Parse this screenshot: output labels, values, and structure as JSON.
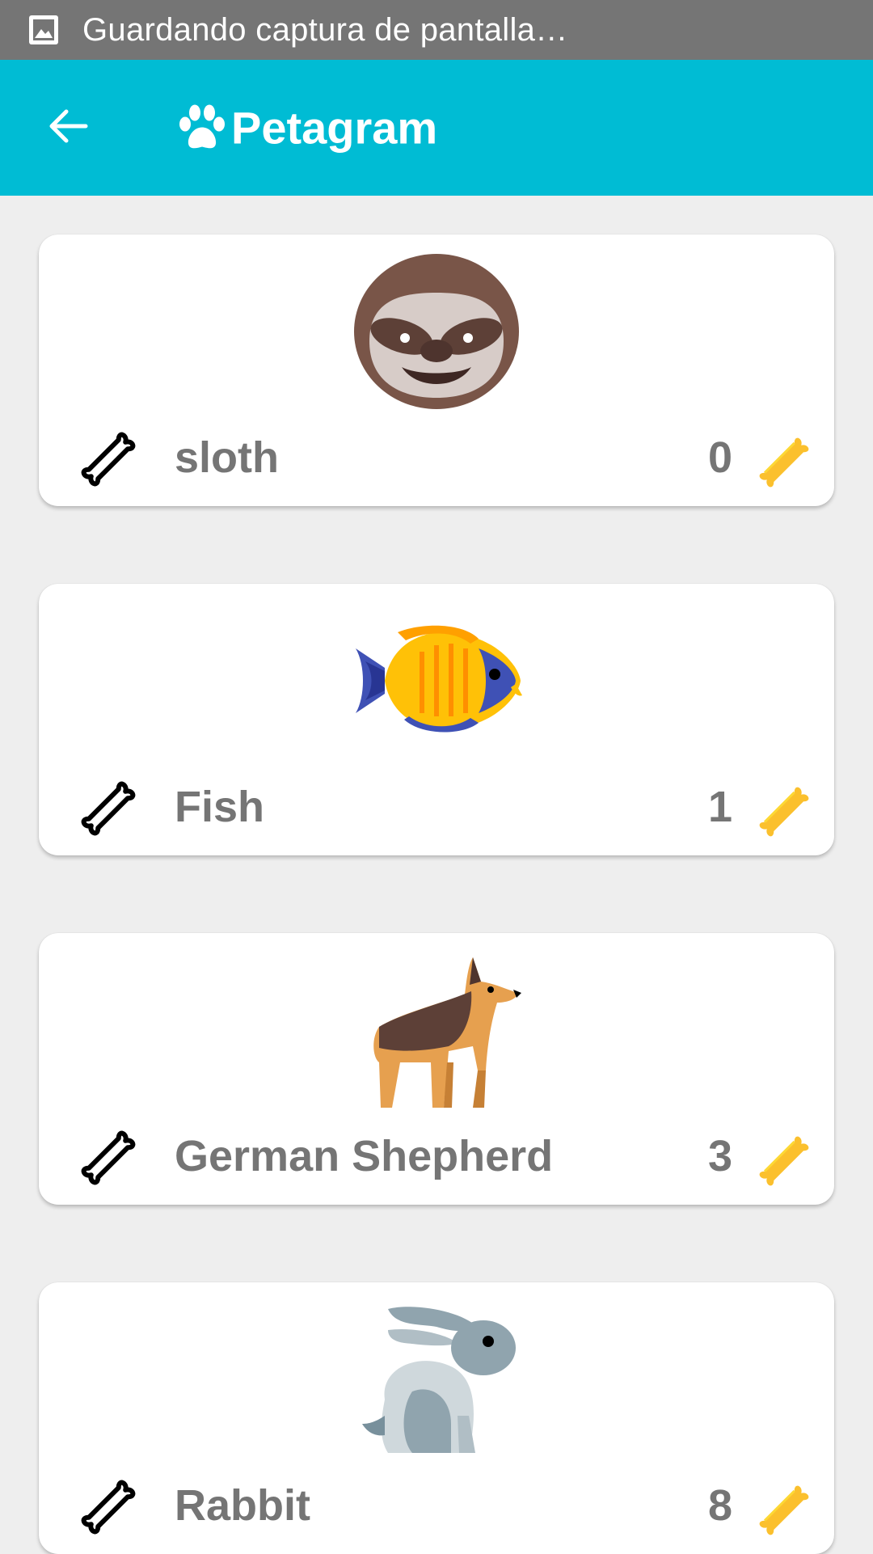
{
  "status_bar": {
    "icon": "image-icon",
    "text": "Guardando captura de pantalla…",
    "background": "#757575"
  },
  "app_bar": {
    "back_icon": "arrow-back-icon",
    "brand_icon": "paw-icon",
    "title": "Petagram",
    "background": "#00bcd4"
  },
  "pets": [
    {
      "name": "sloth",
      "likes": "0",
      "image": "sloth-icon"
    },
    {
      "name": "Fish",
      "likes": "1",
      "image": "fish-icon"
    },
    {
      "name": "German Shepherd",
      "likes": "3",
      "image": "german-shepherd-icon"
    },
    {
      "name": "Rabbit",
      "likes": "8",
      "image": "rabbit-icon"
    }
  ],
  "colors": {
    "text_gray": "#757575",
    "bone_gold": "#fbc02d",
    "bone_outline": "#000000"
  }
}
